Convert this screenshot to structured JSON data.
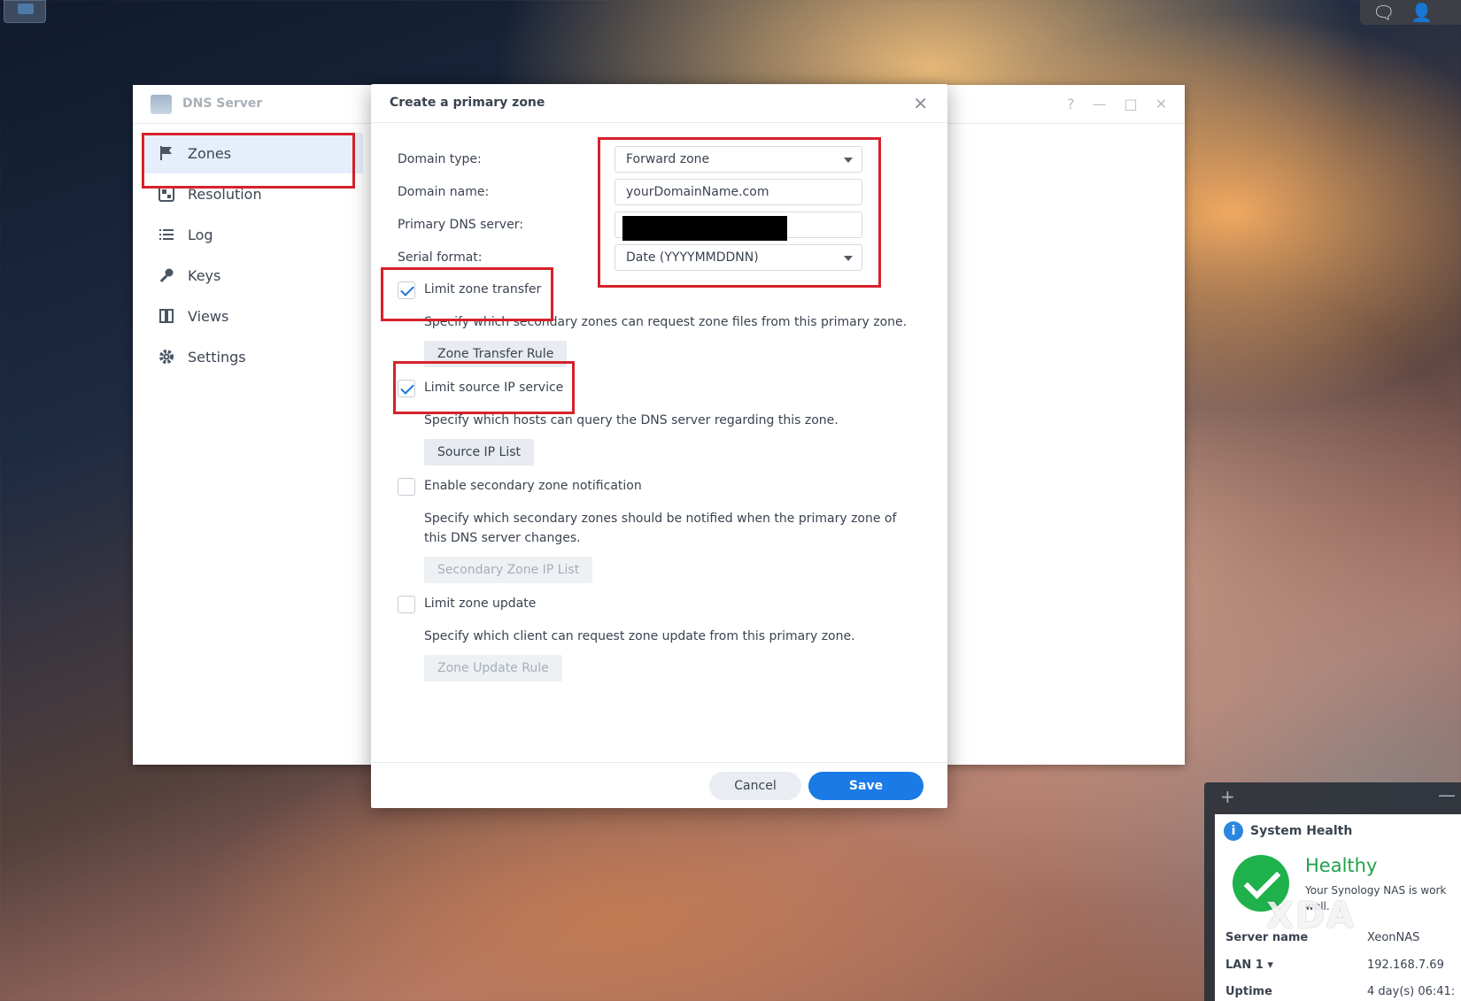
{
  "app": {
    "title": "DNS Server",
    "nav": [
      {
        "label": "Zones",
        "icon": "flag-icon",
        "active": true
      },
      {
        "label": "Resolution",
        "icon": "resolution-icon"
      },
      {
        "label": "Log",
        "icon": "list-icon"
      },
      {
        "label": "Keys",
        "icon": "key-icon"
      },
      {
        "label": "Views",
        "icon": "book-icon"
      },
      {
        "label": "Settings",
        "icon": "gear-icon"
      }
    ]
  },
  "dialog": {
    "title": "Create a primary zone",
    "domain_type": {
      "label": "Domain type:",
      "value": "Forward zone"
    },
    "domain_name": {
      "label": "Domain name:",
      "value": "yourDomainName.com"
    },
    "primary_dns": {
      "label": "Primary DNS server:",
      "value": ""
    },
    "serial_format": {
      "label": "Serial format:",
      "value": "Date (YYYYMMDDNN)"
    },
    "options": [
      {
        "label": "Limit zone transfer",
        "checked": true,
        "desc": "Specify which secondary zones can request zone files from this primary zone.",
        "button": "Zone Transfer Rule",
        "button_disabled": false
      },
      {
        "label": "Limit source IP service",
        "checked": true,
        "desc": "Specify which hosts can query the DNS server regarding this zone.",
        "button": "Source IP List",
        "button_disabled": false
      },
      {
        "label": "Enable secondary zone notification",
        "checked": false,
        "desc": "Specify which secondary zones should be notified when the primary zone of this DNS server changes.",
        "button": "Secondary Zone IP List",
        "button_disabled": true
      },
      {
        "label": "Limit zone update",
        "checked": false,
        "desc": "Specify which client can request zone update from this primary zone.",
        "button": "Zone Update Rule",
        "button_disabled": true
      }
    ],
    "cancel_label": "Cancel",
    "save_label": "Save"
  },
  "widget": {
    "title": "System Health",
    "status": "Healthy",
    "status_desc_line1": "Your Synology NAS is work",
    "status_desc_line2": "well.",
    "rows": [
      {
        "label": "Server name",
        "value": "XeonNAS"
      },
      {
        "label": "LAN 1 ▾",
        "value": "192.168.7.69"
      },
      {
        "label": "Uptime",
        "value": "4 day(s) 06:41:"
      }
    ]
  },
  "watermark": "XDA",
  "colors": {
    "accent": "#1a7ae6",
    "highlight_box": "#d6222b",
    "healthy": "#1fa34a"
  }
}
